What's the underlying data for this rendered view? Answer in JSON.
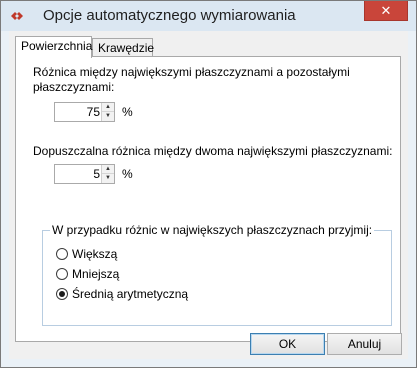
{
  "window": {
    "title": "Opcje automatycznego wymiarowania",
    "close_glyph": "✕",
    "accent_color": "#c9453a"
  },
  "tabs": [
    {
      "label": "Powierzchnia",
      "active": true
    },
    {
      "label": "Krawędzie",
      "active": false
    }
  ],
  "surface": {
    "diff_label_line1": "Różnica między największymi płaszczyznami a pozostałymi",
    "diff_label_line2": "płaszczyznami:",
    "diff_value": "75",
    "diff_unit": "%",
    "allowed_label": "Dopuszczalna różnica między dwoma największymi płaszczyznami:",
    "allowed_value": "5",
    "allowed_unit": "%",
    "group_title": "W przypadku różnic w największych płaszczyznach przyjmij:",
    "options": [
      {
        "label": "Większą",
        "checked": false
      },
      {
        "label": "Mniejszą",
        "checked": false
      },
      {
        "label": "Średnią arytmetyczną",
        "checked": true
      }
    ]
  },
  "buttons": {
    "ok": "OK",
    "cancel": "Anuluj"
  },
  "icons": {
    "app": "app-logo-icon",
    "up": "▲",
    "down": "▼"
  }
}
